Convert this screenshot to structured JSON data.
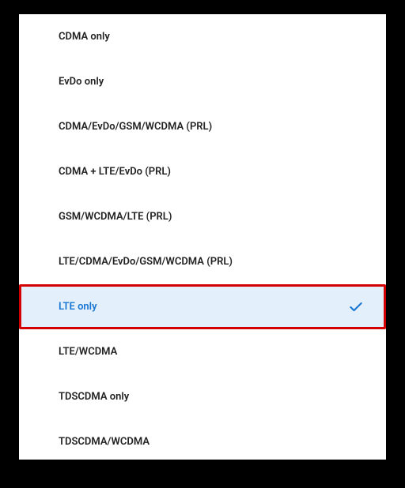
{
  "colors": {
    "accent": "#1976d2",
    "highlight_bg": "#e3f0fb",
    "highlight_border": "#d40000"
  },
  "network_modes": {
    "items": [
      {
        "label": "CDMA only",
        "selected": false
      },
      {
        "label": "EvDo only",
        "selected": false
      },
      {
        "label": "CDMA/EvDo/GSM/WCDMA (PRL)",
        "selected": false
      },
      {
        "label": "CDMA + LTE/EvDo (PRL)",
        "selected": false
      },
      {
        "label": "GSM/WCDMA/LTE (PRL)",
        "selected": false
      },
      {
        "label": "LTE/CDMA/EvDo/GSM/WCDMA (PRL)",
        "selected": false
      },
      {
        "label": "LTE only",
        "selected": true
      },
      {
        "label": "LTE/WCDMA",
        "selected": false
      },
      {
        "label": "TDSCDMA only",
        "selected": false
      },
      {
        "label": "TDSCDMA/WCDMA",
        "selected": false
      }
    ]
  }
}
